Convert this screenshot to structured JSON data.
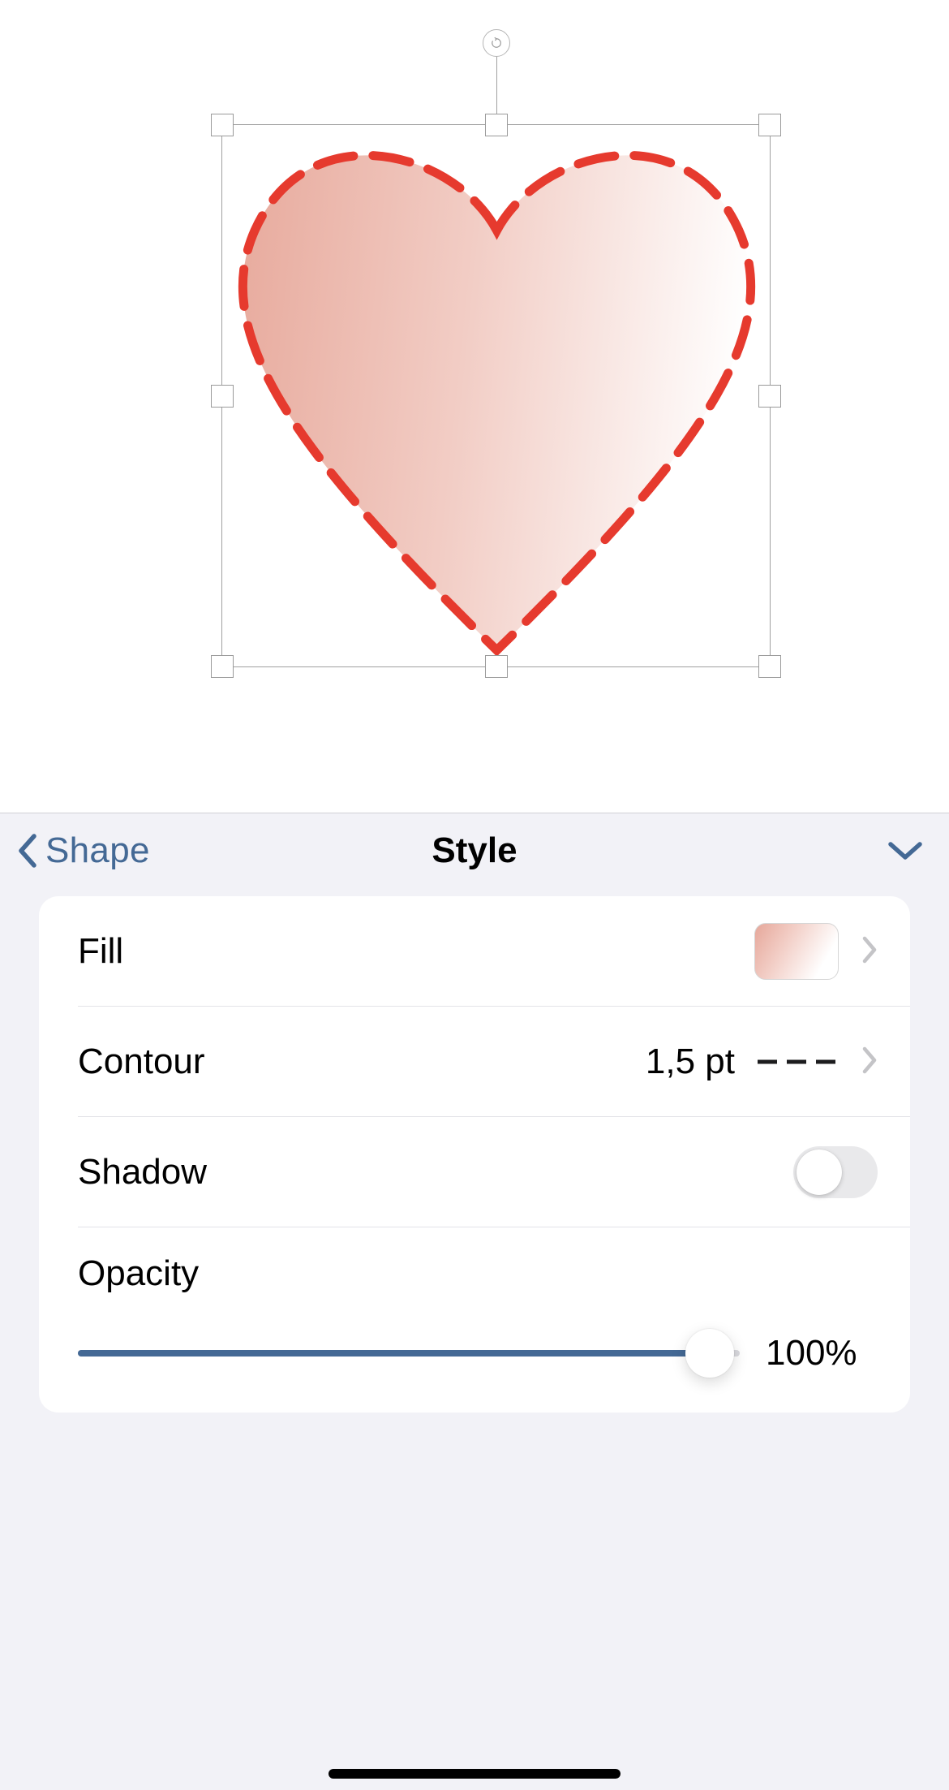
{
  "canvas": {
    "shape": {
      "type": "heart",
      "stroke_color": "#e63a2e",
      "stroke_style": "dashed",
      "fill_gradient": {
        "start": "#e8ac9f",
        "end": "#ffffff"
      }
    }
  },
  "panel": {
    "back_label": "Shape",
    "title": "Style",
    "rows": {
      "fill": {
        "label": "Fill",
        "swatch_gradient": {
          "start": "#e6a79a",
          "end": "#ffffff"
        }
      },
      "contour": {
        "label": "Contour",
        "value": "1,5 pt",
        "style": "dashed"
      },
      "shadow": {
        "label": "Shadow",
        "enabled": false
      },
      "opacity": {
        "label": "Opacity",
        "value": 100,
        "value_display": "100%"
      }
    }
  },
  "colors": {
    "accent": "#446995"
  }
}
